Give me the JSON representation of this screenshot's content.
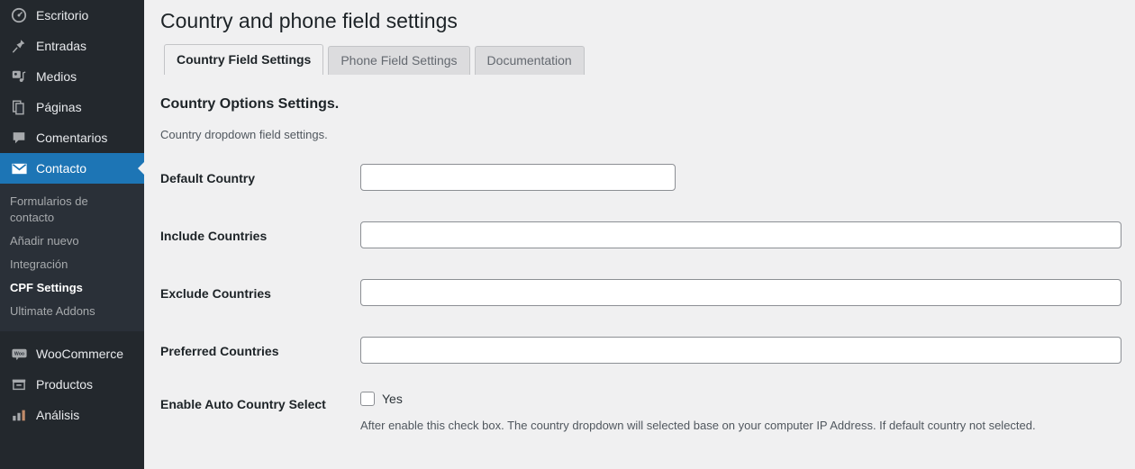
{
  "sidebar": {
    "items": [
      {
        "label": "Escritorio",
        "icon": "dashboard-icon",
        "active": false
      },
      {
        "label": "Entradas",
        "icon": "pin-icon",
        "active": false
      },
      {
        "label": "Medios",
        "icon": "media-icon",
        "active": false
      },
      {
        "label": "Páginas",
        "icon": "pages-icon",
        "active": false
      },
      {
        "label": "Comentarios",
        "icon": "comment-icon",
        "active": false
      },
      {
        "label": "Contacto",
        "icon": "envelope-icon",
        "active": true
      }
    ],
    "submenu": [
      {
        "label": "Formularios de contacto",
        "current": false
      },
      {
        "label": "Añadir nuevo",
        "current": false
      },
      {
        "label": "Integración",
        "current": false
      },
      {
        "label": "CPF Settings",
        "current": true
      },
      {
        "label": "Ultimate Addons",
        "current": false
      }
    ],
    "items_bottom": [
      {
        "label": "WooCommerce",
        "icon": "woocommerce-icon"
      },
      {
        "label": "Productos",
        "icon": "product-box-icon"
      },
      {
        "label": "Análisis",
        "icon": "bar-chart-icon"
      }
    ],
    "colors": {
      "background": "#23282d",
      "submenu_background": "#2a3038",
      "active_background": "#1d75b5",
      "text": "#e8eaed",
      "muted_text": "#a7aaad"
    }
  },
  "page": {
    "title": "Country and phone field settings",
    "tabs": [
      {
        "label": "Country Field Settings",
        "active": true
      },
      {
        "label": "Phone Field Settings",
        "active": false
      },
      {
        "label": "Documentation",
        "active": false
      }
    ],
    "section_title": "Country Options Settings.",
    "section_description": "Country dropdown field settings.",
    "fields": [
      {
        "label": "Default Country",
        "value": "",
        "placeholder": "",
        "width": "narrow"
      },
      {
        "label": "Include Countries",
        "value": "",
        "placeholder": "",
        "width": "wide"
      },
      {
        "label": "Exclude Countries",
        "value": "",
        "placeholder": "",
        "width": "wide"
      },
      {
        "label": "Preferred Countries",
        "value": "",
        "placeholder": "",
        "width": "wide"
      }
    ],
    "checkbox_row": {
      "label": "Enable Auto Country Select",
      "checkbox_label": "Yes",
      "checked": false,
      "description": "After enable this check box. The country dropdown will selected base on your computer IP Address. If default country not selected."
    },
    "colors": {
      "background": "#f0f0f1",
      "text": "#1d2327",
      "muted_text": "#50575e",
      "input_border": "#8c8f94"
    }
  }
}
